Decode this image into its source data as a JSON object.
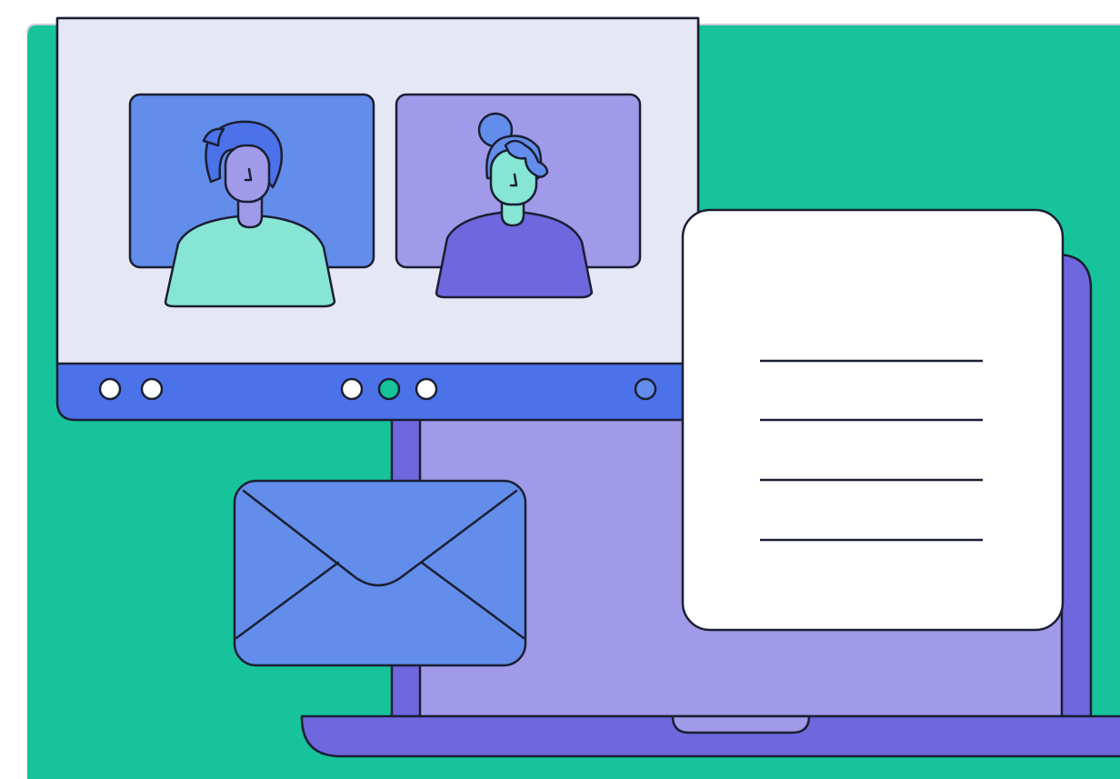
{
  "illustration": {
    "subject": "video-call-laptop-email-document",
    "colors": {
      "background": "#16C39A",
      "page_edge": "#C9CCD6",
      "outline": "#1B1F33",
      "window_body": "#E6E7F4",
      "toolbar": "#4C72EA",
      "tile_left": "#628DEA",
      "tile_right": "#A09AE8",
      "person_left_shirt": "#86E5D3",
      "person_left_skin": "#A09AE8",
      "person_left_hair": "#4C72EA",
      "person_right_shirt": "#6F67DE",
      "person_right_skin": "#86E5D3",
      "person_right_hair": "#628DEA",
      "laptop_body": "#6F67DE",
      "laptop_screen": "#A09AE8",
      "envelope": "#628DEA",
      "document": "#FFFFFF",
      "control_white": "#FFFFFF",
      "control_active": "#16C39A",
      "control_blue": "#628DEA"
    },
    "icons": [
      "video-call-window",
      "person-man-avatar",
      "person-woman-avatar",
      "laptop-icon",
      "envelope-icon",
      "document-icon"
    ],
    "toolbar_controls": {
      "left_count": 2,
      "center_count": 3,
      "center_active_index": 1,
      "right_count": 1
    },
    "document_line_count": 4
  }
}
